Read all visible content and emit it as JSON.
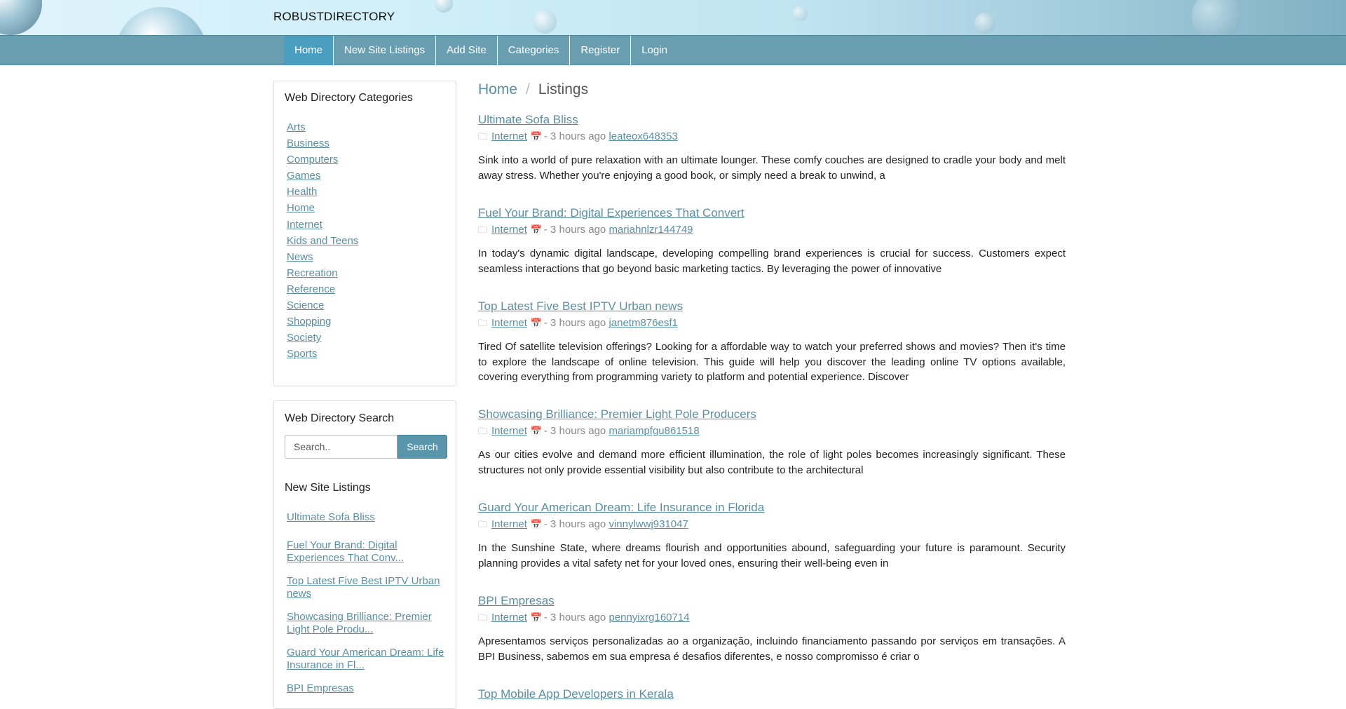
{
  "site": {
    "brand": "ROBUSTDIRECTORY"
  },
  "nav": {
    "items": [
      {
        "label": "Home",
        "active": true
      },
      {
        "label": "New Site Listings",
        "active": false
      },
      {
        "label": "Add Site",
        "active": false
      },
      {
        "label": "Categories",
        "active": false
      },
      {
        "label": "Register",
        "active": false
      },
      {
        "label": "Login",
        "active": false
      }
    ]
  },
  "sidebar": {
    "categories_title": "Web Directory Categories",
    "categories": [
      "Arts",
      "Business",
      "Computers",
      "Games",
      "Health",
      "Home",
      "Internet",
      "Kids and Teens",
      "News",
      "Recreation",
      "Reference",
      "Science",
      "Shopping",
      "Society",
      "Sports"
    ],
    "search_title": "Web Directory Search",
    "search_placeholder": "Search..",
    "search_button": "Search",
    "new_listings_title": "New Site Listings",
    "new_listings": [
      "Ultimate Sofa Bliss",
      "Fuel Your Brand: Digital Experiences That Conv...",
      "Top Latest Five Best IPTV Urban news",
      "Showcasing Brilliance: Premier Light Pole Produ...",
      "Guard Your American Dream: Life Insurance in Fl...",
      "BPI Empresas"
    ]
  },
  "breadcrumb": {
    "home": "Home",
    "separator": "/",
    "current": "Listings"
  },
  "listings": [
    {
      "title": "Ultimate Sofa Bliss",
      "category": "Internet",
      "time": "- 3 hours ago",
      "user": "leateox648353",
      "description": "Sink into a world of pure relaxation with an ultimate lounger. These comfy couches are designed to cradle your body and melt away stress. Whether you're enjoying a good book, or simply need a break to unwind, a"
    },
    {
      "title": "Fuel Your Brand: Digital Experiences That Convert",
      "category": "Internet",
      "time": "- 3 hours ago",
      "user": "mariahnlzr144749",
      "description": "In today's dynamic digital landscape, developing compelling brand experiences is crucial for success. Customers expect seamless interactions that go beyond basic marketing tactics. By leveraging the power of innovative"
    },
    {
      "title": "Top Latest Five Best IPTV Urban news",
      "category": "Internet",
      "time": "- 3 hours ago",
      "user": "janetm876esf1",
      "description": "Tired Of satellite television offerings? Looking for a affordable way to watch your preferred shows and movies? Then it's time to explore the landscape of online television. This guide will help you discover the leading online TV options available, covering everything from programming variety to platform and potential experience. Discover"
    },
    {
      "title": "Showcasing Brilliance: Premier Light Pole Producers",
      "category": "Internet",
      "time": "- 3 hours ago",
      "user": "mariampfgu861518",
      "description": "As our cities evolve and demand more efficient illumination, the role of light poles becomes increasingly significant. These structures not only provide essential visibility but also contribute to the architectural"
    },
    {
      "title": "Guard Your American Dream: Life Insurance in Florida",
      "category": "Internet",
      "time": "- 3 hours ago",
      "user": "vinnylwwj931047",
      "description": "In the Sunshine State, where dreams flourish and opportunities abound, safeguarding your future is paramount. Security planning provides a vital safety net for your loved ones, ensuring their well-being even in"
    },
    {
      "title": "BPI Empresas",
      "category": "Internet",
      "time": "- 3 hours ago",
      "user": "pennyixrg160714",
      "description": "Apresentamos serviços personalizadas ao a organização, incluindo financiamento passando por serviços em transações. A BPI Business, sabemos em sua empresa é desafios diferentes, e nosso compromisso é criar o"
    },
    {
      "title": "Top Mobile App Developers in Kerala",
      "category": "",
      "time": "",
      "user": "",
      "description": ""
    }
  ]
}
